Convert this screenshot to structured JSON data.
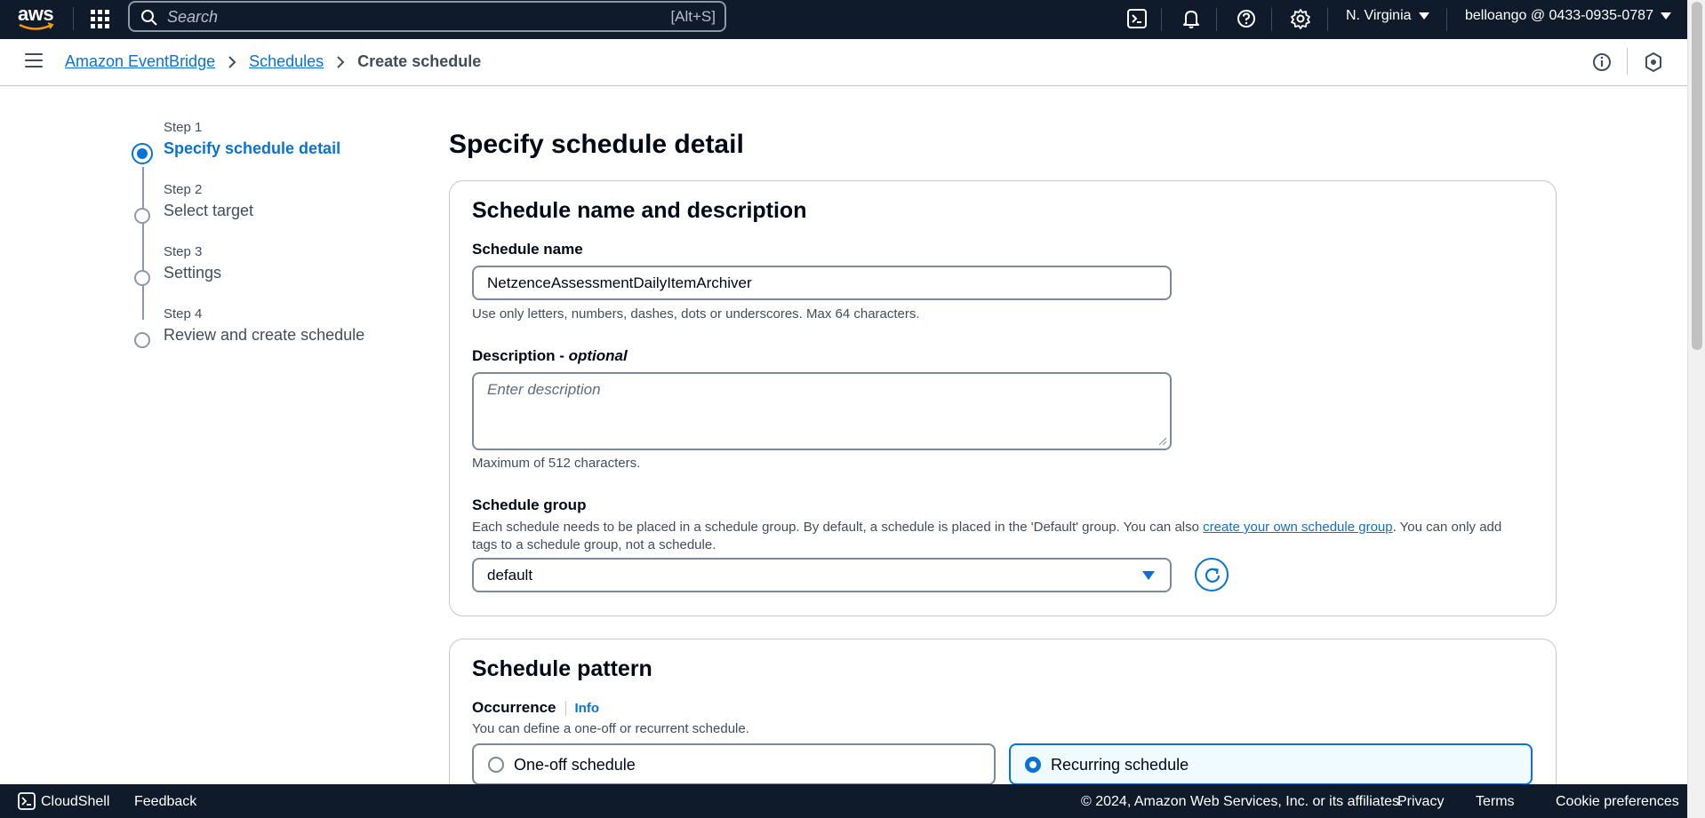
{
  "topnav": {
    "logo_text": "aws",
    "search_placeholder": "Search",
    "search_shortcut": "[Alt+S]",
    "icons": [
      "cloudshell-icon",
      "bell-icon",
      "help-icon",
      "gear-icon"
    ],
    "region": "N. Virginia",
    "account": "belloango @ 0433-0935-0787"
  },
  "breadcrumb": {
    "items": [
      "Amazon EventBridge",
      "Schedules"
    ],
    "current": "Create schedule"
  },
  "steps": [
    {
      "label": "Step 1",
      "title": "Specify schedule detail",
      "active": true
    },
    {
      "label": "Step 2",
      "title": "Select target",
      "active": false
    },
    {
      "label": "Step 3",
      "title": "Settings",
      "active": false
    },
    {
      "label": "Step 4",
      "title": "Review and create schedule",
      "active": false
    }
  ],
  "page": {
    "title": "Specify schedule detail"
  },
  "name_section": {
    "heading": "Schedule name and description",
    "name_label": "Schedule name",
    "name_value": "NetzenceAssessmentDailyItemArchiver",
    "name_hint": "Use only letters, numbers, dashes, dots or underscores. Max 64 characters.",
    "desc_label": "Description - ",
    "desc_optional": "optional",
    "desc_placeholder": "Enter description",
    "desc_hint": "Maximum of 512 characters.",
    "group_label": "Schedule group",
    "group_hint_pre": "Each schedule needs to be placed in a schedule group. By default, a schedule is placed in the 'Default' group. You can also ",
    "group_hint_link": "create your own schedule group",
    "group_hint_post": ". You can only add tags to a schedule group, not a schedule.",
    "group_value": "default"
  },
  "pattern_section": {
    "heading": "Schedule pattern",
    "occurrence_label": "Occurrence",
    "info": "Info",
    "occurrence_hint": "You can define a one-off or recurrent schedule.",
    "options": [
      "One-off schedule",
      "Recurring schedule"
    ],
    "selected": "Recurring schedule"
  },
  "footer": {
    "cloudshell": "CloudShell",
    "feedback": "Feedback",
    "copyright": "© 2024, Amazon Web Services, Inc. or its affiliates.",
    "privacy": "Privacy",
    "terms": "Terms",
    "cookies": "Cookie preferences"
  },
  "colors": {
    "nav_bg": "#0f1b2a",
    "accent": "#0972d3",
    "text": "#000716",
    "muted": "#414d5c"
  }
}
